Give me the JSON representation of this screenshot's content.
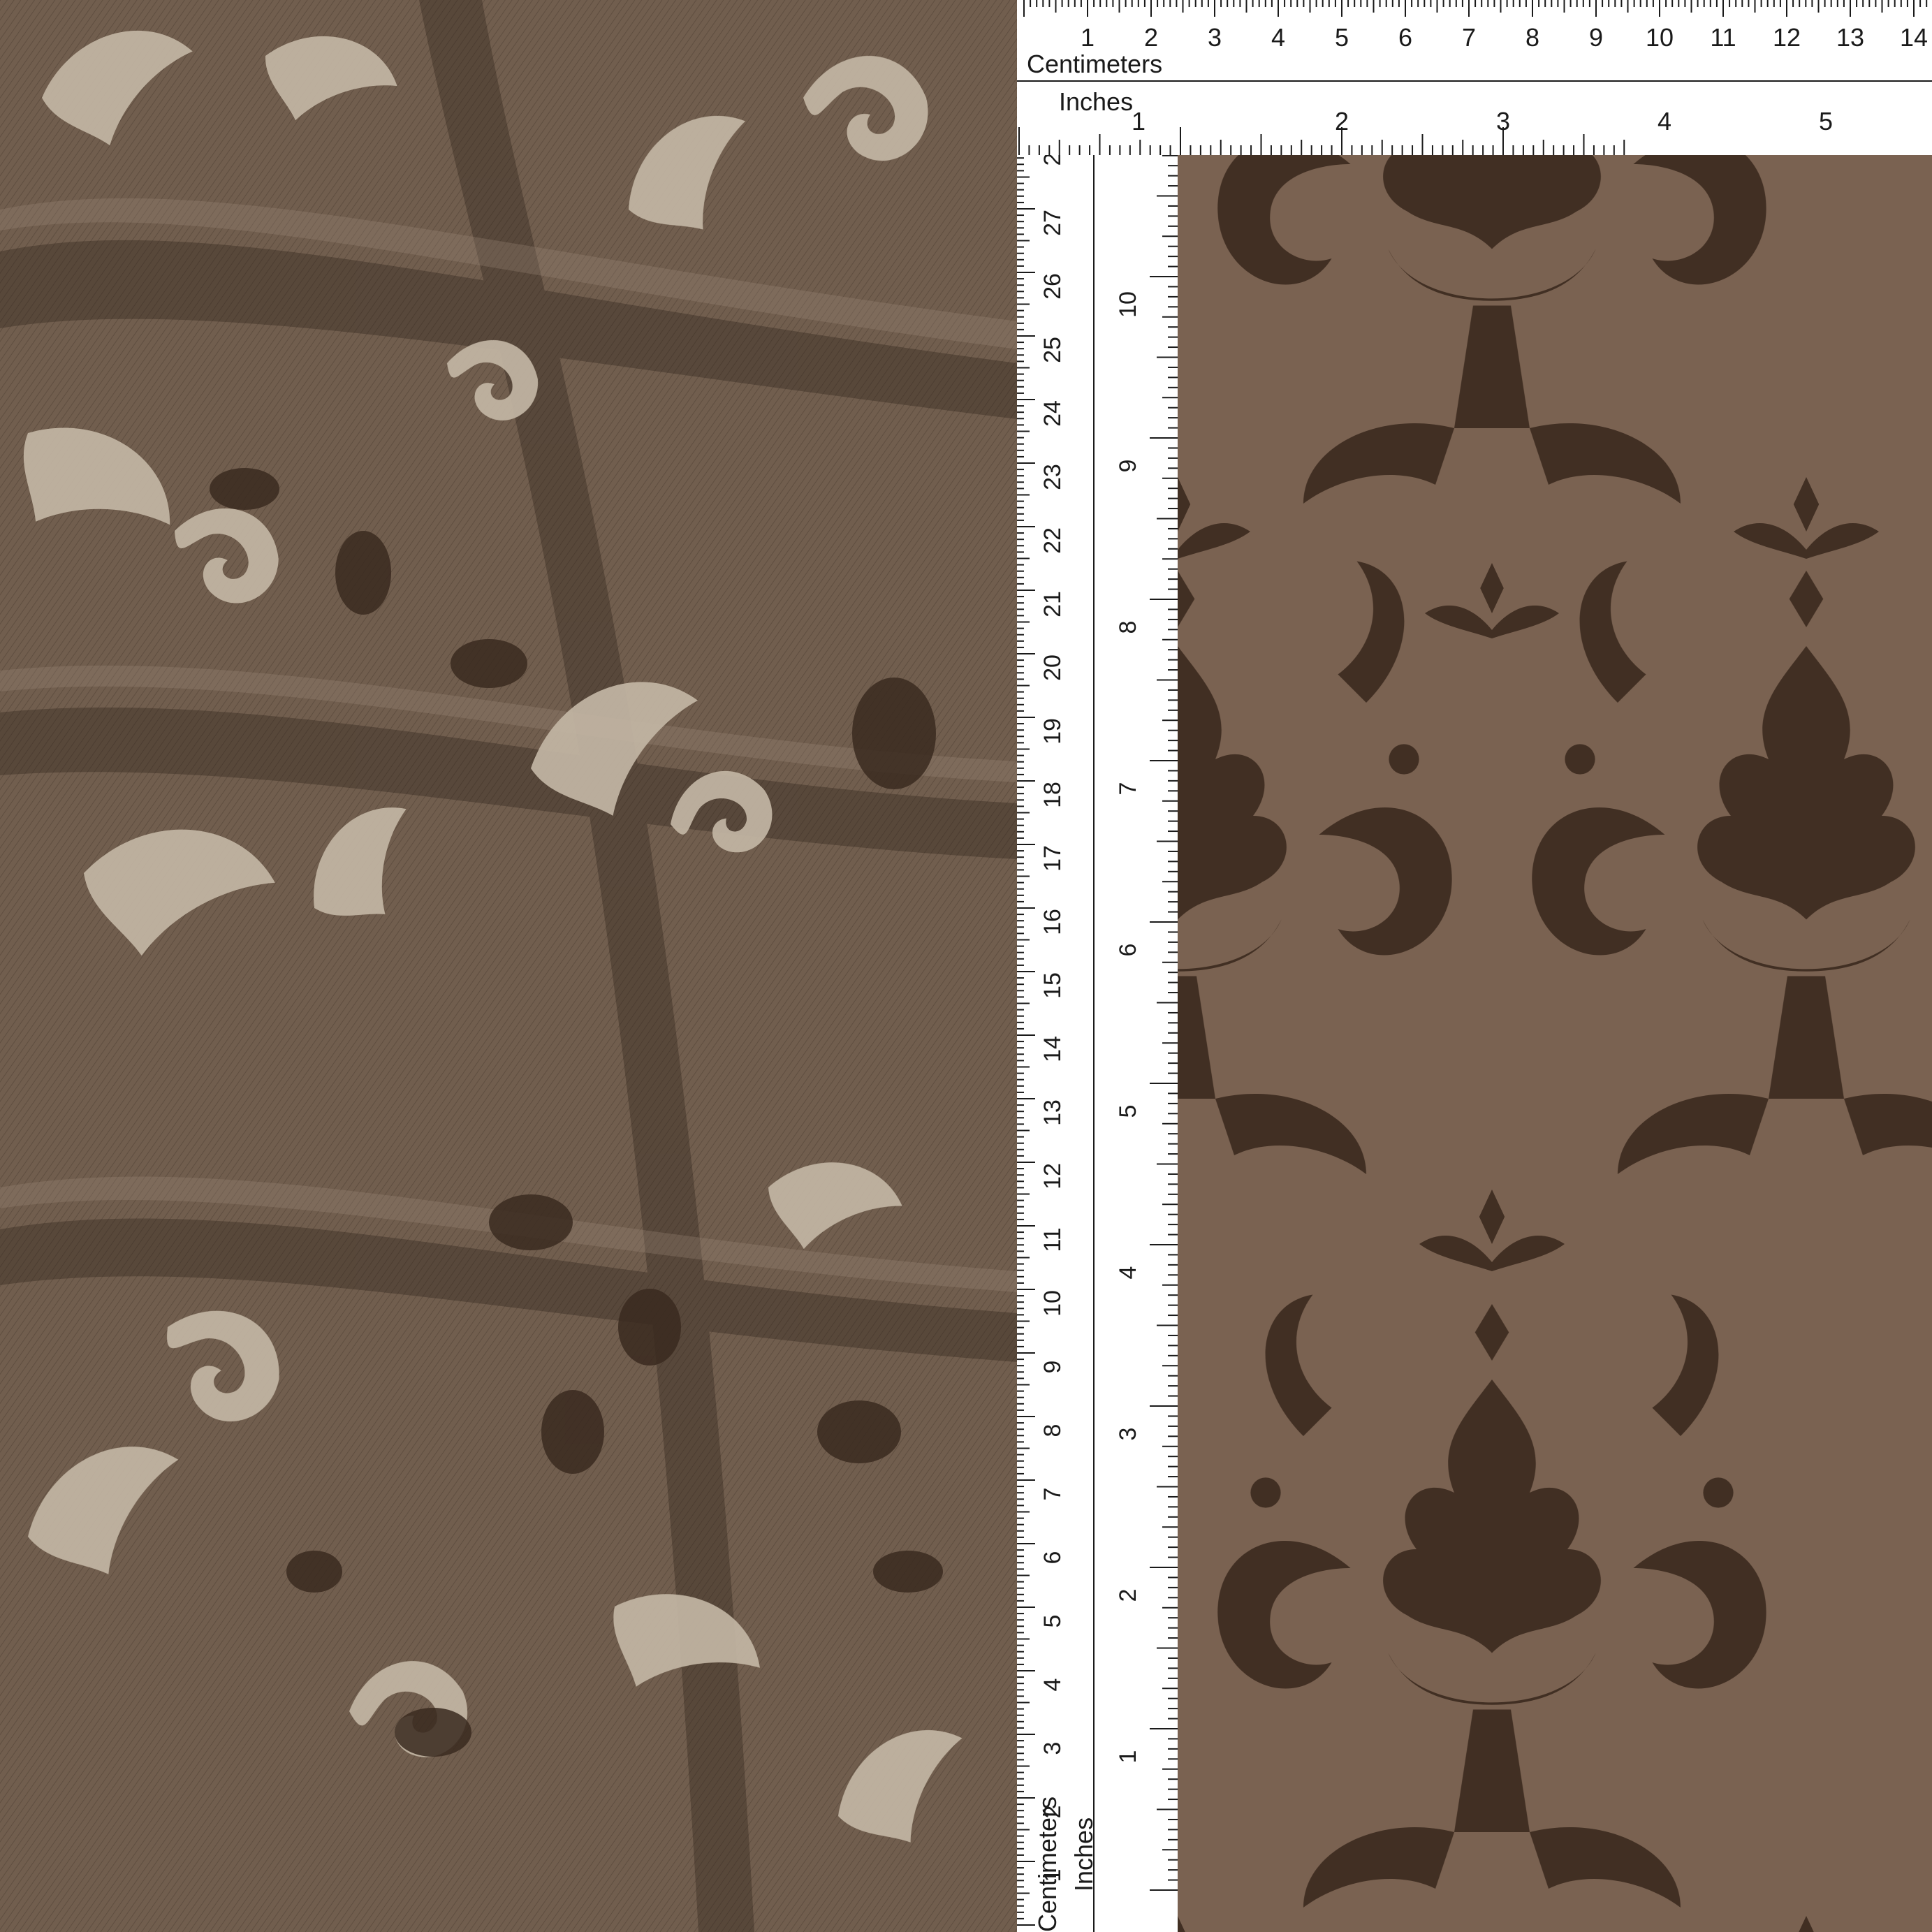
{
  "colors": {
    "fabric_base": "#73604f",
    "draped_pattern_light": "#c3b7a5",
    "draped_pattern_dark": "#3a2a20",
    "flat_base": "#7a6251",
    "flat_pattern": "#3b2a1f",
    "ruler_bg": "#ffffff",
    "ruler_ink": "#1a1a1a"
  },
  "ruler_top": {
    "cm_label": "Centimeters",
    "in_label": "Inches",
    "cm_numbers": [
      "1",
      "2",
      "3",
      "4",
      "5",
      "6",
      "7",
      "8",
      "9",
      "10",
      "11",
      "12",
      "13",
      "14"
    ],
    "in_numbers": [
      "1",
      "2",
      "3",
      "4",
      "5"
    ]
  },
  "ruler_left": {
    "cm_label": "Centimeters",
    "in_label": "Inches",
    "cm_numbers": [
      "1",
      "2",
      "3",
      "4",
      "5",
      "6",
      "7",
      "8",
      "9",
      "10",
      "11",
      "12",
      "13",
      "14",
      "15",
      "16",
      "17",
      "18",
      "19",
      "20",
      "21",
      "22",
      "23",
      "24",
      "25",
      "26",
      "27",
      "2"
    ],
    "in_numbers": [
      "1",
      "2",
      "3",
      "4",
      "5",
      "6",
      "7",
      "8",
      "9",
      "10",
      "1"
    ]
  }
}
